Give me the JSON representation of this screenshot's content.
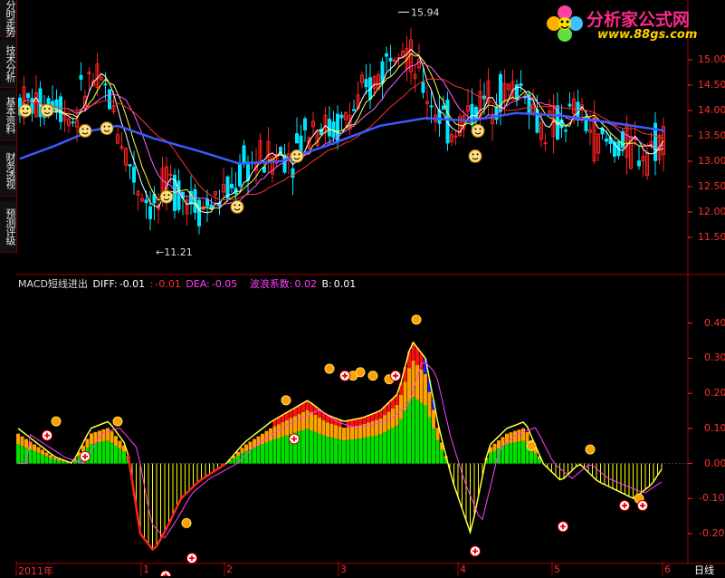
{
  "left_tabs": [
    "分时走势",
    "技术分析",
    "基本资料",
    "财务透视",
    "预测评级"
  ],
  "logo": {
    "title": "分析家公式网",
    "url": "www.88gs.com"
  },
  "colors": {
    "up": "#ff2020",
    "down": "#00e5ff",
    "ma_blue": "#3a5bff",
    "ma_red": "#ff3030",
    "ma_yellow": "#ffff40",
    "ma_white": "#ffffff",
    "hist_green": "#00e000",
    "hist_orange": "#ffa000",
    "hist_red": "#ff1010",
    "hist_blue": "#0020ff",
    "hist_yellow": "#ffff00",
    "axis": "#ff3030",
    "dea": "#ff40ff"
  },
  "macd": {
    "name": "MACD短线进出",
    "diff_label": "DIFF:",
    "diff_value": "-0.01",
    "sep": ":",
    "dea_prefix": "-0.01",
    "dea_label": "DEA:",
    "dea_value": "-0.05",
    "coef_label": "波浪系数:",
    "coef_value": "0.02",
    "b_label": "B:",
    "b_value": "0.01"
  },
  "period_label": "日线",
  "chart_data": [
    {
      "type": "candlestick",
      "y_ticks": [
        "15.00",
        "14.50",
        "14.00",
        "13.50",
        "13.00",
        "12.50",
        "12.00",
        "11.50"
      ],
      "ylim": [
        11.0,
        16.0
      ],
      "annotations": [
        "15.94",
        "←11.21"
      ],
      "x_ticks": [
        "2011年",
        "1",
        "2",
        "3",
        "4",
        "5",
        "6"
      ],
      "high_marker": 15.94,
      "low_marker": 11.21
    },
    {
      "type": "bar",
      "series_name": "MACD",
      "y_ticks": [
        "0.40",
        "0.30",
        "0.20",
        "0.10",
        "0.00",
        "-0.10",
        "-0.20"
      ],
      "ylim": [
        -0.28,
        0.5
      ],
      "diff": -0.01,
      "dea": -0.05,
      "coef": 0.02,
      "b": 0.01
    }
  ]
}
